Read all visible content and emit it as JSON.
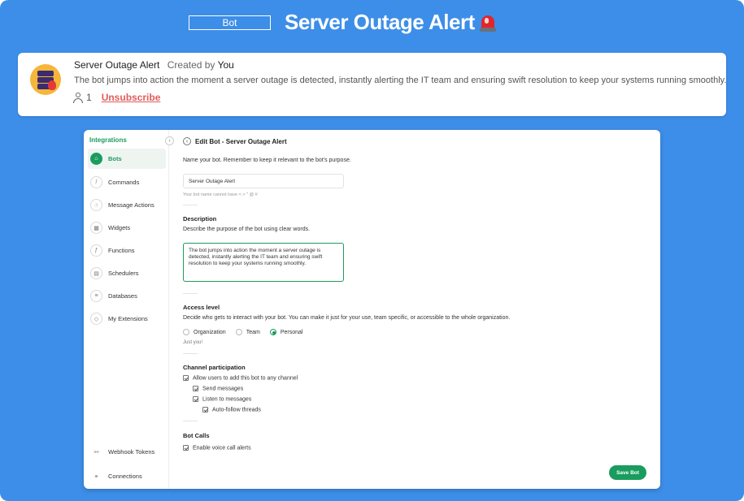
{
  "header": {
    "tag": "Bot",
    "title": "Server Outage Alert"
  },
  "card": {
    "name": "Server Outage Alert",
    "created_by_label": "Created by",
    "created_by": "You",
    "description": "The bot jumps into action the moment a server outage is detected, instantly alerting the IT team and ensuring swift resolution to keep your systems running smoothly.",
    "subscriber_count": "1",
    "unsubscribe": "Unsubscribe"
  },
  "sidebar": {
    "title": "Integrations",
    "items": [
      {
        "label": "Bots",
        "icon": "home-icon",
        "active": true
      },
      {
        "label": "Commands",
        "icon": "slash-icon"
      },
      {
        "label": "Message Actions",
        "icon": "hand-icon"
      },
      {
        "label": "Widgets",
        "icon": "grid-icon"
      },
      {
        "label": "Functions",
        "icon": "function-icon"
      },
      {
        "label": "Schedulers",
        "icon": "calendar-icon"
      },
      {
        "label": "Databases",
        "icon": "database-icon"
      },
      {
        "label": "My Extensions",
        "icon": "extension-icon"
      }
    ],
    "bottom": [
      {
        "label": "Webhook Tokens",
        "icon": "webhook-icon"
      },
      {
        "label": "Connections",
        "icon": "connections-icon"
      }
    ]
  },
  "form": {
    "title": "Edit Bot - Server Outage Alert",
    "name_prompt": "Name your bot. Remember to keep it relevant to the bot's purpose.",
    "name_value": "Server Outage Alert",
    "name_hint": "Your bot name cannot have < > \" @ #",
    "description_heading": "Description",
    "description_prompt": "Describe the purpose of the bot using clear words.",
    "description_value": "The bot jumps into action the moment a server outage is detected, instantly alerting the IT team and ensuring swift resolution to keep your systems running smoothly.",
    "access_heading": "Access level",
    "access_prompt": "Decide who gets to interact with your bot. You can make it just for your use, team specific, or accessible to the whole organization.",
    "access_options": [
      "Organization",
      "Team",
      "Personal"
    ],
    "access_selected": "Personal",
    "access_note": "Just you!",
    "channel_heading": "Channel participation",
    "channel_allow": "Allow users to add this bot to any channel",
    "channel_send": "Send messages",
    "channel_listen": "Listen to messages",
    "channel_autofollow": "Auto-follow threads",
    "calls_heading": "Bot Calls",
    "calls_enable": "Enable voice call alerts",
    "save_label": "Save Bot"
  },
  "colors": {
    "background": "#3d8ee8",
    "accent": "#1a9c5e",
    "unsubscribe": "#e25b5b"
  }
}
